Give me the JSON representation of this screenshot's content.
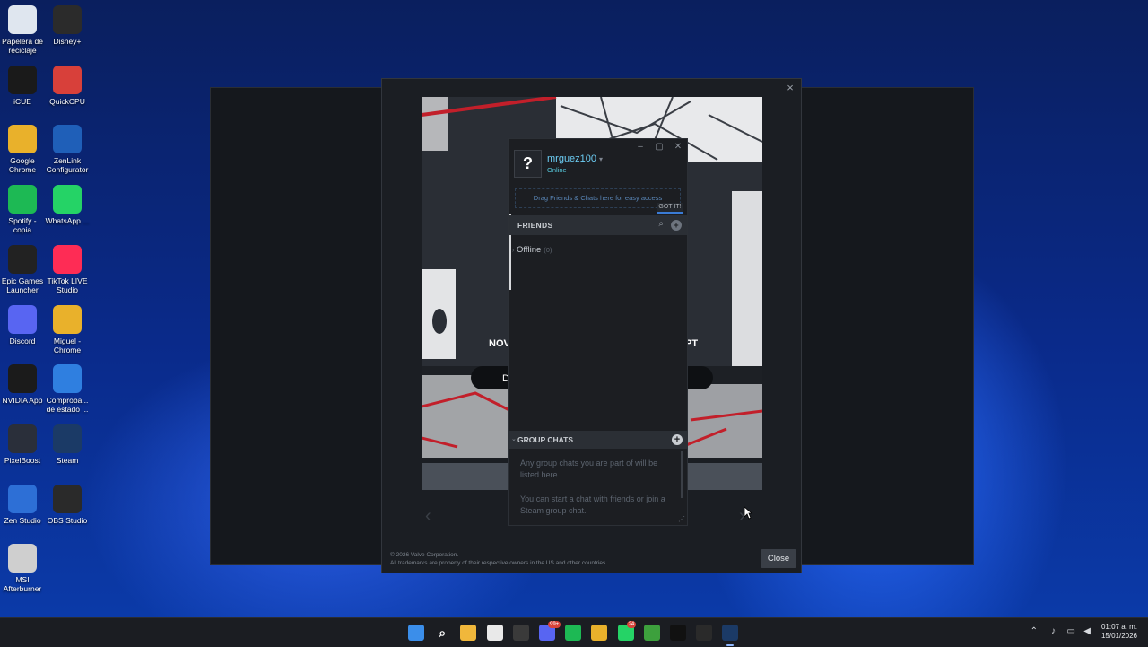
{
  "desktop": {
    "icons": [
      {
        "label": "Papelera de reciclaje",
        "icon": "recycle-bin-icon",
        "color": "#dfe6ef"
      },
      {
        "label": "Disney+",
        "icon": "disney-plus-icon",
        "color": "#2b2b2b"
      },
      {
        "label": "iCUE",
        "icon": "icue-icon",
        "color": "#1a1a1a"
      },
      {
        "label": "QuickCPU",
        "icon": "quickcpu-icon",
        "color": "#d8403a"
      },
      {
        "label": "Google Chrome",
        "icon": "chrome-icon",
        "color": "#e9b12b"
      },
      {
        "label": "ZenLink Configurator",
        "icon": "zenlink-icon",
        "color": "#1f5fb8"
      },
      {
        "label": "Spotify - copia",
        "icon": "spotify-icon",
        "color": "#1db954"
      },
      {
        "label": "WhatsApp ...",
        "icon": "whatsapp-icon",
        "color": "#25d366"
      },
      {
        "label": "Epic Games Launcher",
        "icon": "epic-games-icon",
        "color": "#222222"
      },
      {
        "label": "TikTok LIVE Studio",
        "icon": "tiktok-live-icon",
        "color": "#fe2c55"
      },
      {
        "label": "Discord",
        "icon": "discord-icon",
        "color": "#5865f2"
      },
      {
        "label": "Miguel - Chrome",
        "icon": "chrome-profile-icon",
        "color": "#e9b12b"
      },
      {
        "label": "NVIDIA App",
        "icon": "nvidia-icon",
        "color": "#1b1b1b"
      },
      {
        "label": "Comproba... de estado ...",
        "icon": "pc-health-icon",
        "color": "#2f7fe0"
      },
      {
        "label": "PixelBoost",
        "icon": "pixelboost-icon",
        "color": "#2a2f3a"
      },
      {
        "label": "Steam",
        "icon": "steam-icon",
        "color": "#1b3a66"
      },
      {
        "label": "Zen Studio",
        "icon": "zen-studio-icon",
        "color": "#2d6fd6"
      },
      {
        "label": "OBS Studio",
        "icon": "obs-icon",
        "color": "#2a2a2a"
      },
      {
        "label": "MSI Afterburner",
        "icon": "msi-afterburner-icon",
        "color": "#cfcfcf"
      }
    ]
  },
  "dialog": {
    "close_glyph": "×",
    "promo_text_left": "NOV",
    "promo_text_right": "PT",
    "promo_button_letter": "D",
    "legal_line1": "© 2026 Valve Corporation.",
    "legal_line2": "All trademarks are property of their respective owners in the US and other countries.",
    "close_button": "Close"
  },
  "friends_window": {
    "username": "mrguez100",
    "status": "Online",
    "avatar_glyph": "?",
    "drag_hint": "Drag Friends & Chats here for easy access",
    "got_it": "GOT IT!",
    "friends_label": "FRIENDS",
    "offline_label": "Offline",
    "offline_count": "(0)",
    "group_chats_label": "GROUP CHATS",
    "group_chats_text1": "Any group chats you are part of will be listed here.",
    "group_chats_text2": "You can start a chat with friends or join a Steam group chat."
  },
  "taskbar": {
    "apps": [
      "windows-start",
      "search",
      "file-explorer",
      "microsoft-store",
      "obs",
      "discord",
      "spotify",
      "chrome",
      "whatsapp",
      "xbox",
      "tiktok",
      "steam-helper",
      "steam"
    ],
    "discord_badge": "99+",
    "whatsapp_badge": "24",
    "time": "01:07 a. m.",
    "date": "15/01/2026"
  }
}
